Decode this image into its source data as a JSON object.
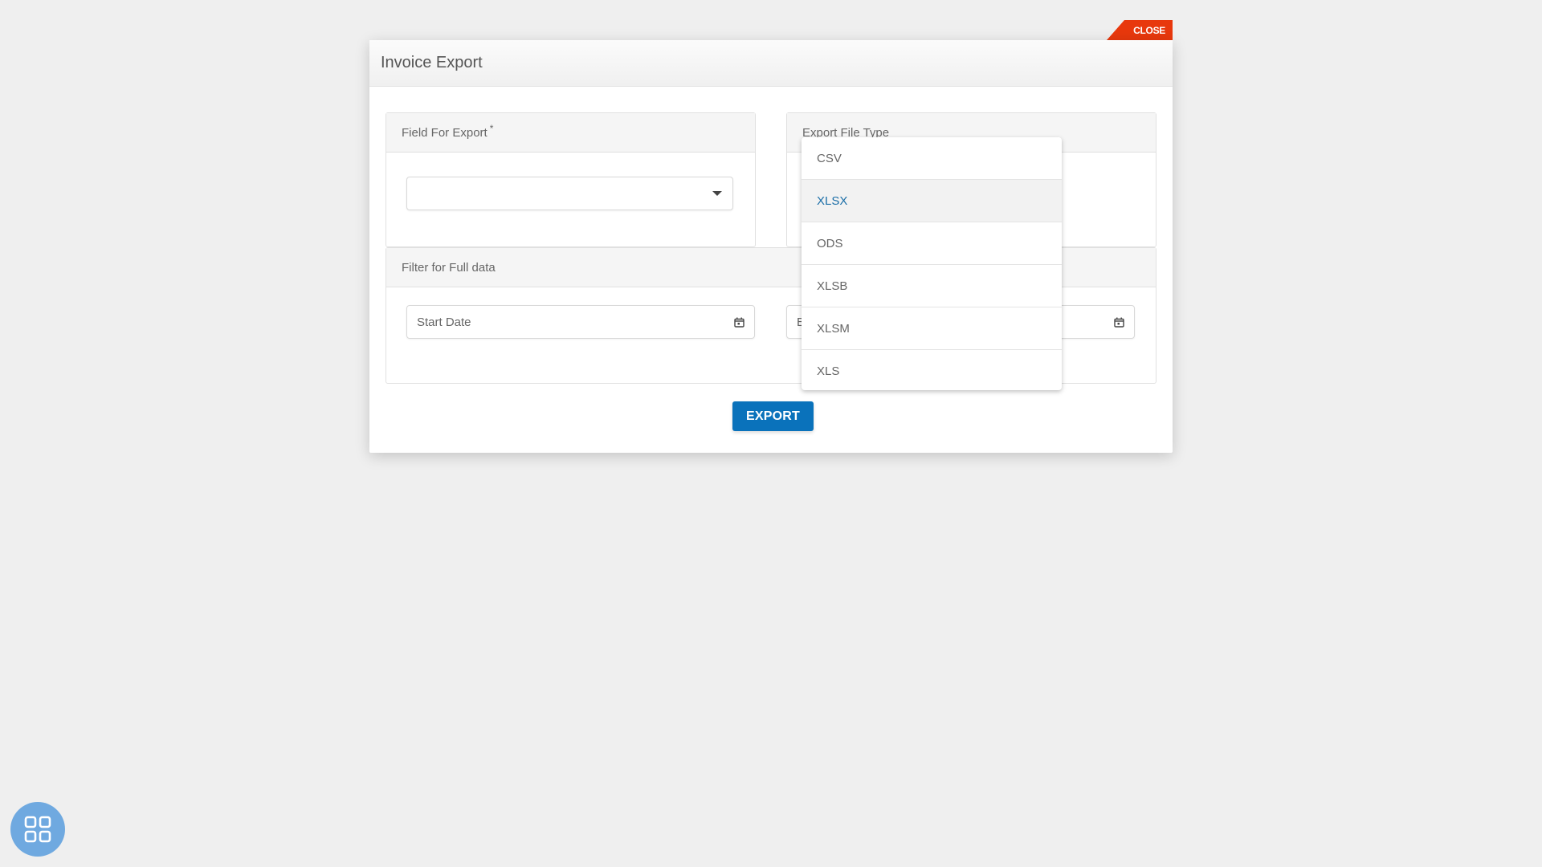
{
  "modal": {
    "title": "Invoice Export",
    "close_label": "CLOSE",
    "export_button_label": "EXPORT"
  },
  "field_panel": {
    "title": "Field For Export",
    "required_marker": "*",
    "select_value": ""
  },
  "file_type_panel": {
    "title": "Export File Type",
    "options": [
      "CSV",
      "XLSX",
      "ODS",
      "XLSB",
      "XLSM",
      "XLS"
    ],
    "highlighted_option": "XLSX"
  },
  "filter_panel": {
    "title": "Filter for Full data",
    "start_date_placeholder": "Start Date",
    "end_date_placeholder": "End Date"
  },
  "colors": {
    "close_tab": "#e8380d",
    "export_button": "#0a72bb",
    "highlight_text": "#1c6fa8",
    "apps_button": "#6fa9e0"
  },
  "icons": {
    "calendar": "calendar-icon",
    "caret": "chevron-down-icon",
    "apps": "grid-icon"
  }
}
